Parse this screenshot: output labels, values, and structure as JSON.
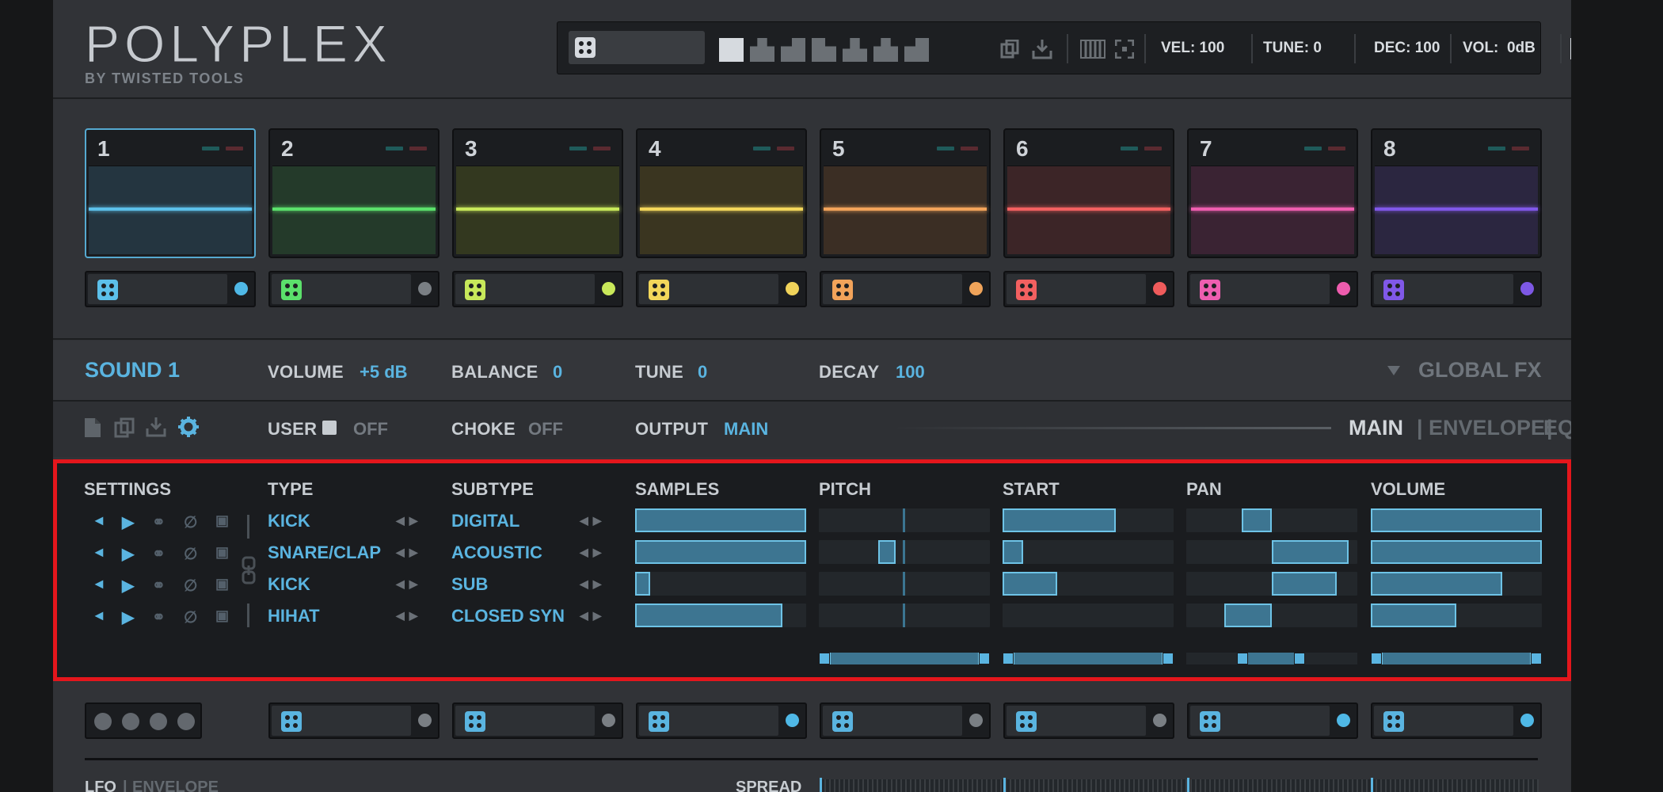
{
  "header": {
    "logo": "POLYPLEX",
    "logo_sub": "BY TWISTED TOOLS",
    "preset_name": "",
    "vel": "VEL: 100",
    "tune": "TUNE: 0",
    "dec": "DEC: 100",
    "vol": "VOL:  0dB"
  },
  "pads": [
    {
      "num": "1",
      "color": "#5cc0ea",
      "bg": "#243540",
      "dot": "#4fb8e6"
    },
    {
      "num": "2",
      "color": "#5be06b",
      "bg": "#243a2a",
      "dot": "#7a7f84"
    },
    {
      "num": "3",
      "color": "#c7e85a",
      "bg": "#33381f",
      "dot": "#c9e85a"
    },
    {
      "num": "4",
      "color": "#f2d65a",
      "bg": "#3a3520",
      "dot": "#f0d35a"
    },
    {
      "num": "5",
      "color": "#f2a35a",
      "bg": "#3b2e24",
      "dot": "#f0a45a"
    },
    {
      "num": "6",
      "color": "#f26060",
      "bg": "#3c2527",
      "dot": "#ef5b5b"
    },
    {
      "num": "7",
      "color": "#ee5eb0",
      "bg": "#3a2333",
      "dot": "#ee5cae"
    },
    {
      "num": "8",
      "color": "#8058e8",
      "bg": "#2b2640",
      "dot": "#7d58e4"
    }
  ],
  "sound": {
    "name": "SOUND 1",
    "volume_label": "VOLUME",
    "volume": "+5 dB",
    "balance_label": "BALANCE",
    "balance": "0",
    "tune_label": "TUNE",
    "tune": "0",
    "decay_label": "DECAY",
    "decay": "100",
    "global_fx": "GLOBAL FX"
  },
  "panel": {
    "user_label": "USER",
    "user": "OFF",
    "choke_label": "CHOKE",
    "choke": "OFF",
    "output_label": "OUTPUT",
    "output": "MAIN",
    "tab_main": "MAIN",
    "tab_env": "ENVELOPE",
    "tab_eq": "EQ",
    "sep": "|"
  },
  "columns": {
    "settings": "SETTINGS",
    "type": "TYPE",
    "subtype": "SUBTYPE",
    "samples": "SAMPLES",
    "pitch": "PITCH",
    "start": "START",
    "pan": "PAN",
    "volume": "VOLUME"
  },
  "layers": [
    {
      "type": "KICK",
      "subtype": "DIGITAL",
      "samples": 1.0,
      "pitch": 0.0,
      "start": 0.66,
      "pan": 0.0,
      "volume": 1.0
    },
    {
      "type": "SNARE/CLAP",
      "subtype": "ACOUSTIC",
      "samples": 1.0,
      "pitch": -0.1,
      "start": 0.12,
      "pan": 0.45,
      "volume": 1.0
    },
    {
      "type": "KICK",
      "subtype": "SUB",
      "samples": 0.09,
      "pitch": 0.0,
      "start": 0.32,
      "pan": 0.38,
      "volume": 0.77
    },
    {
      "type": "HIHAT",
      "subtype": "CLOSED SYN",
      "samples": 0.86,
      "pitch": 0.0,
      "start": 0.0,
      "pan": -0.28,
      "volume": 0.5
    }
  ],
  "bottom": {
    "lfo": "LFO",
    "envelope": "ENVELOPE",
    "sep": "|",
    "spread": "SPREAD",
    "dots": [
      "#7a7f84",
      "#7a7f84",
      "#4fb8e6",
      "#7a7f84",
      "#7a7f84",
      "#4fb8e6",
      "#4fb8e6"
    ]
  }
}
